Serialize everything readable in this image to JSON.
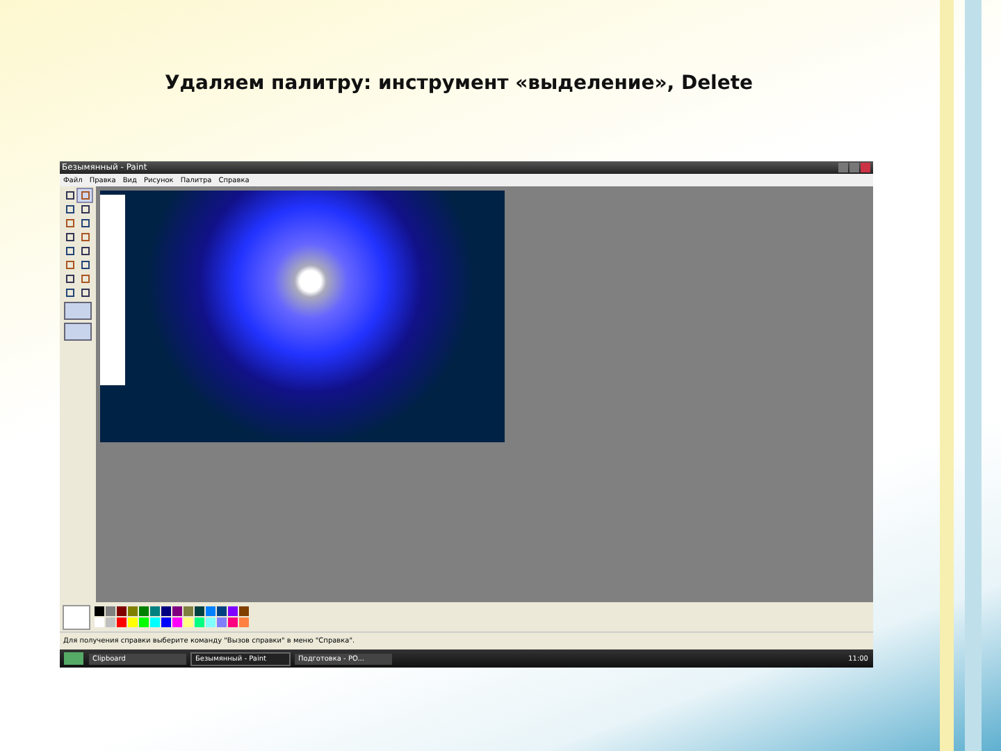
{
  "slide": {
    "title": "Удаляем палитру: инструмент «выделение», Delete"
  },
  "window": {
    "title": "Безымянный - Paint"
  },
  "menu": [
    "Файл",
    "Правка",
    "Вид",
    "Рисунок",
    "Палитра",
    "Справка"
  ],
  "tools": [
    {
      "selected": false
    },
    {
      "selected": true
    },
    {
      "selected": false
    },
    {
      "selected": false
    },
    {
      "selected": false
    },
    {
      "selected": false
    },
    {
      "selected": false
    },
    {
      "selected": false
    },
    {
      "selected": false
    },
    {
      "selected": false
    },
    {
      "selected": false
    },
    {
      "selected": false
    },
    {
      "selected": false
    },
    {
      "selected": false
    },
    {
      "selected": false
    },
    {
      "selected": false
    }
  ],
  "palette": [
    {
      "color": "#000000"
    },
    {
      "color": "#808080"
    },
    {
      "color": "#800000"
    },
    {
      "color": "#808000"
    },
    {
      "color": "#008000"
    },
    {
      "color": "#008080"
    },
    {
      "color": "#000080"
    },
    {
      "color": "#800080"
    },
    {
      "color": "#808040"
    },
    {
      "color": "#004040"
    },
    {
      "color": "#0080ff"
    },
    {
      "color": "#004080"
    },
    {
      "color": "#8000ff"
    },
    {
      "color": "#804000"
    },
    {
      "color": "#ffffff"
    },
    {
      "color": "#c0c0c0"
    },
    {
      "color": "#ff0000"
    },
    {
      "color": "#ffff00"
    },
    {
      "color": "#00ff00"
    },
    {
      "color": "#00ffff"
    },
    {
      "color": "#0000ff"
    },
    {
      "color": "#ff00ff"
    },
    {
      "color": "#ffff80"
    },
    {
      "color": "#00ff80"
    },
    {
      "color": "#80ffff"
    },
    {
      "color": "#8080ff"
    },
    {
      "color": "#ff0080"
    },
    {
      "color": "#ff8040"
    }
  ],
  "status_bar": "Для получения справки выберите команду \"Вызов справки\" в меню \"Справка\".",
  "taskbar": {
    "items": [
      {
        "label": "Clipboard",
        "selected": false
      },
      {
        "label": "Безымянный - Paint",
        "selected": true
      },
      {
        "label": "Подготовка - PO...",
        "selected": false
      }
    ],
    "clock": "11:00"
  }
}
